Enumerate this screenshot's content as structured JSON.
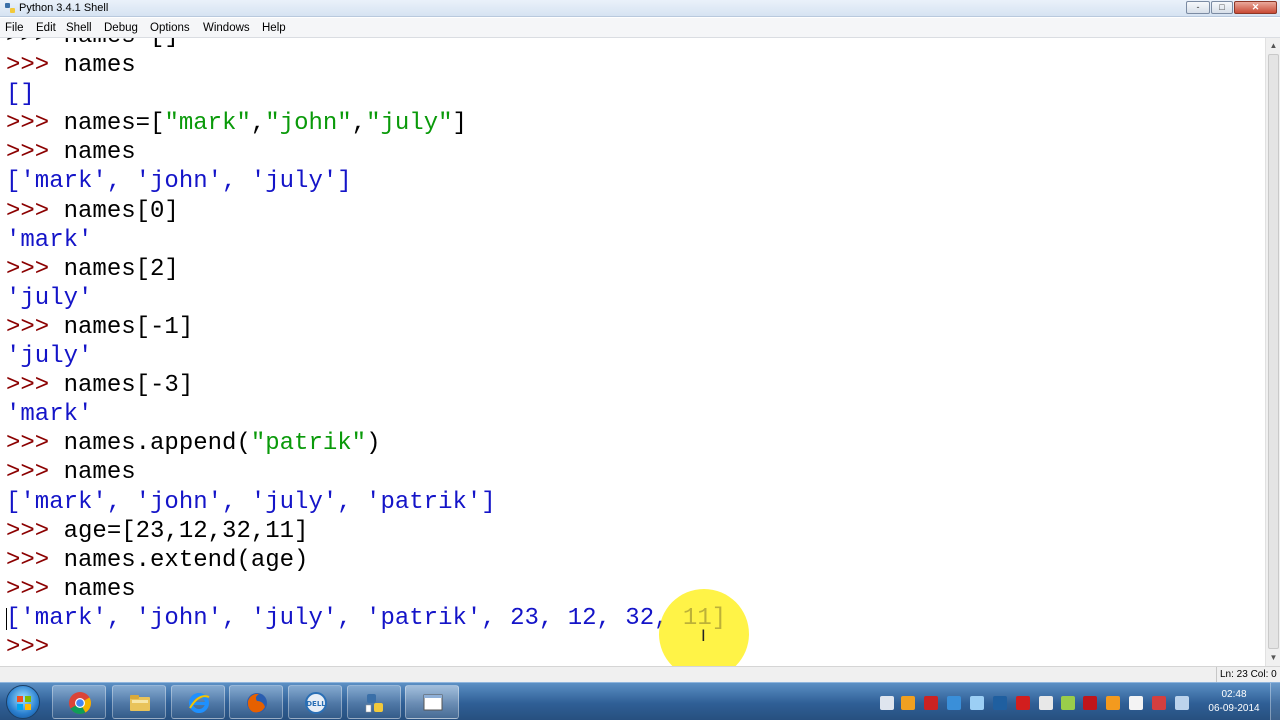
{
  "window": {
    "title": "Python 3.4.1 Shell",
    "controls": {
      "minimize": "-",
      "maximize": "□",
      "close": "✕"
    }
  },
  "menu": [
    "File",
    "Edit",
    "Shell",
    "Debug",
    "Options",
    "Windows",
    "Help"
  ],
  "shell": {
    "partial_top_line": ">>> names=[]",
    "lines": [
      {
        "segments": [
          {
            "t": ">>> ",
            "c": "prompt"
          },
          {
            "t": "names",
            "c": "stdin"
          }
        ]
      },
      {
        "segments": [
          {
            "t": "[]",
            "c": "out"
          }
        ]
      },
      {
        "segments": [
          {
            "t": ">>> ",
            "c": "prompt"
          },
          {
            "t": "names=[",
            "c": "stdin"
          },
          {
            "t": "\"mark\"",
            "c": "str"
          },
          {
            "t": ",",
            "c": "stdin"
          },
          {
            "t": "\"john\"",
            "c": "str"
          },
          {
            "t": ",",
            "c": "stdin"
          },
          {
            "t": "\"july\"",
            "c": "str"
          },
          {
            "t": "]",
            "c": "stdin"
          }
        ]
      },
      {
        "segments": [
          {
            "t": ">>> ",
            "c": "prompt"
          },
          {
            "t": "names",
            "c": "stdin"
          }
        ]
      },
      {
        "segments": [
          {
            "t": "['mark', 'john', 'july']",
            "c": "out"
          }
        ]
      },
      {
        "segments": [
          {
            "t": ">>> ",
            "c": "prompt"
          },
          {
            "t": "names[0]",
            "c": "stdin"
          }
        ]
      },
      {
        "segments": [
          {
            "t": "'mark'",
            "c": "out"
          }
        ]
      },
      {
        "segments": [
          {
            "t": ">>> ",
            "c": "prompt"
          },
          {
            "t": "names[2]",
            "c": "stdin"
          }
        ]
      },
      {
        "segments": [
          {
            "t": "'july'",
            "c": "out"
          }
        ]
      },
      {
        "segments": [
          {
            "t": ">>> ",
            "c": "prompt"
          },
          {
            "t": "names[-1]",
            "c": "stdin"
          }
        ]
      },
      {
        "segments": [
          {
            "t": "'july'",
            "c": "out"
          }
        ]
      },
      {
        "segments": [
          {
            "t": ">>> ",
            "c": "prompt"
          },
          {
            "t": "names[-3]",
            "c": "stdin"
          }
        ]
      },
      {
        "segments": [
          {
            "t": "'mark'",
            "c": "out"
          }
        ]
      },
      {
        "segments": [
          {
            "t": ">>> ",
            "c": "prompt"
          },
          {
            "t": "names.append(",
            "c": "stdin"
          },
          {
            "t": "\"patrik\"",
            "c": "str"
          },
          {
            "t": ")",
            "c": "stdin"
          }
        ]
      },
      {
        "segments": [
          {
            "t": ">>> ",
            "c": "prompt"
          },
          {
            "t": "names",
            "c": "stdin"
          }
        ]
      },
      {
        "segments": [
          {
            "t": "['mark', 'john', 'july', 'patrik']",
            "c": "out"
          }
        ]
      },
      {
        "segments": [
          {
            "t": ">>> ",
            "c": "prompt"
          },
          {
            "t": "age=[23,12,32,11]",
            "c": "stdin"
          }
        ]
      },
      {
        "segments": [
          {
            "t": ">>> ",
            "c": "prompt"
          },
          {
            "t": "names.extend(age)",
            "c": "stdin"
          }
        ]
      },
      {
        "segments": [
          {
            "t": ">>> ",
            "c": "prompt"
          },
          {
            "t": "names",
            "c": "stdin"
          }
        ]
      },
      {
        "segments": [
          {
            "t": "['mark', 'john', 'july', 'patrik', 23, 12, 32, 11]",
            "c": "out"
          }
        ]
      },
      {
        "segments": [
          {
            "t": ">>> ",
            "c": "prompt"
          }
        ]
      }
    ],
    "colors": {
      "prompt": "#8b0000",
      "stdin": "#000000",
      "str": "#0a9a0a",
      "out": "#1414c8"
    }
  },
  "status": {
    "position": "Ln: 23 Col: 0"
  },
  "taskbar": {
    "apps": [
      "chrome-icon",
      "explorer-icon",
      "internet-explorer-icon",
      "firefox-icon",
      "dell-icon",
      "python-icon",
      "idle-window-icon"
    ],
    "clock_time": "02:48",
    "clock_date": "06-09-2014"
  }
}
